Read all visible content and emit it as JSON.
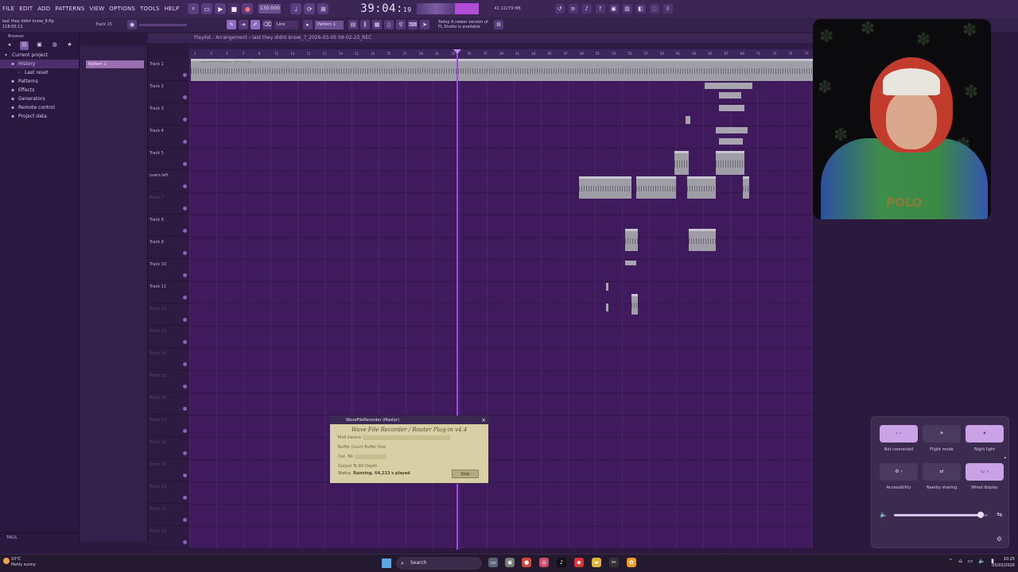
{
  "menubar": {
    "items": [
      "FILE",
      "EDIT",
      "ADD",
      "PATTERNS",
      "VIEW",
      "OPTIONS",
      "TOOLS",
      "HELP"
    ],
    "tempo": "130.000",
    "clock": "39:04",
    "clock_sub": "19",
    "cpu_text": "41   12279 MB"
  },
  "toolbar2": {
    "project_name": "last they didnt know_8.flp",
    "project_time": "118:05:11",
    "track_label": "Track 15",
    "snap": "Line",
    "pattern": "Pattern 1",
    "news": "Today  A newer version of FL Studio is available"
  },
  "browser": {
    "header": "Browser",
    "items": [
      {
        "label": "Current project",
        "level": 0,
        "icon": "folder-icon"
      },
      {
        "label": "History",
        "level": 1,
        "icon": "history-icon"
      },
      {
        "label": "Last reset",
        "level": 2,
        "icon": "reset-icon"
      },
      {
        "label": "Patterns",
        "level": 1,
        "icon": "patterns-icon"
      },
      {
        "label": "Effects",
        "level": 1,
        "icon": "effects-icon"
      },
      {
        "label": "Generators",
        "level": 1,
        "icon": "generators-icon"
      },
      {
        "label": "Remote control",
        "level": 1,
        "icon": "remote-icon"
      },
      {
        "label": "Project data",
        "level": 1,
        "icon": "project-data-icon"
      }
    ],
    "footer": "TAGS"
  },
  "playlist": {
    "title": "Playlist - Arrangement › last they didnt know_7_2026-03-05 09-02-23_REC",
    "pattern_item": "Pattern 1",
    "first_clip": "They Didnt Know_k... Track 1 #1",
    "ruler": [
      "1",
      "3",
      "5",
      "7",
      "9",
      "11",
      "13",
      "15",
      "17",
      "19",
      "21",
      "23",
      "25",
      "27",
      "29",
      "31",
      "33",
      "35",
      "37",
      "39",
      "41",
      "43",
      "45",
      "47",
      "49",
      "51",
      "53",
      "55",
      "57",
      "59",
      "61",
      "63",
      "65",
      "67",
      "69",
      "71",
      "73",
      "75",
      "77"
    ],
    "tracks": [
      {
        "name": "Track 1",
        "dim": false
      },
      {
        "name": "Track 2",
        "dim": false
      },
      {
        "name": "Track 3",
        "dim": false
      },
      {
        "name": "Track 4",
        "dim": false
      },
      {
        "name": "Track 5",
        "dim": false
      },
      {
        "name": "overs left",
        "dim": false
      },
      {
        "name": "Track 7",
        "dim": true
      },
      {
        "name": "Track 8",
        "dim": false
      },
      {
        "name": "Track 9",
        "dim": false
      },
      {
        "name": "Track 10",
        "dim": false
      },
      {
        "name": "Track 11",
        "dim": false
      },
      {
        "name": "Track 12",
        "dim": true
      },
      {
        "name": "Track 13",
        "dim": true
      },
      {
        "name": "Track 14",
        "dim": true
      },
      {
        "name": "Track 15",
        "dim": true
      },
      {
        "name": "Track 16",
        "dim": true
      },
      {
        "name": "Track 17",
        "dim": true
      },
      {
        "name": "Track 18",
        "dim": true
      },
      {
        "name": "Track 19",
        "dim": true
      },
      {
        "name": "Track 20",
        "dim": true
      },
      {
        "name": "Track 21",
        "dim": true
      },
      {
        "name": "Track 22",
        "dim": true
      }
    ]
  },
  "plugin": {
    "window_title": "WaveFileRecorder (Master)",
    "title": "Wave File Recorder / Router Plug-in v4.4",
    "rows": [
      "Midi Device",
      "Buffer Count      Buffer Size",
      "Out. Bit",
      "Output To      Bit Depth"
    ],
    "status_label": "Status",
    "status_value": "Running. 64,213 s played",
    "stop_label": "Stop"
  },
  "quick_settings": {
    "tiles": [
      {
        "label": "Not connected",
        "on": true,
        "icon": "bluetooth-icon",
        "glyph": "‹ ›"
      },
      {
        "label": "Flight mode",
        "on": false,
        "icon": "airplane-icon",
        "glyph": "✈"
      },
      {
        "label": "Night light",
        "on": true,
        "icon": "night-light-icon",
        "glyph": "☀"
      },
      {
        "label": "Accessibility",
        "on": false,
        "icon": "accessibility-icon",
        "glyph": "⚙ ›"
      },
      {
        "label": "Nearby sharing",
        "on": false,
        "icon": "share-icon",
        "glyph": "⇄"
      },
      {
        "label": "Wired display",
        "on": true,
        "icon": "display-icon",
        "glyph": "▭ ›"
      }
    ],
    "volume": 0.92
  },
  "taskbar": {
    "weather_temp": "10°C",
    "weather_desc": "Partly sunny",
    "search": "Search",
    "time": "10:25",
    "date": "05/03/2026"
  },
  "colors": {
    "accent": "#a24be0",
    "playlist_bg": "#3f1a5c",
    "clip": "#9f9ea6"
  }
}
